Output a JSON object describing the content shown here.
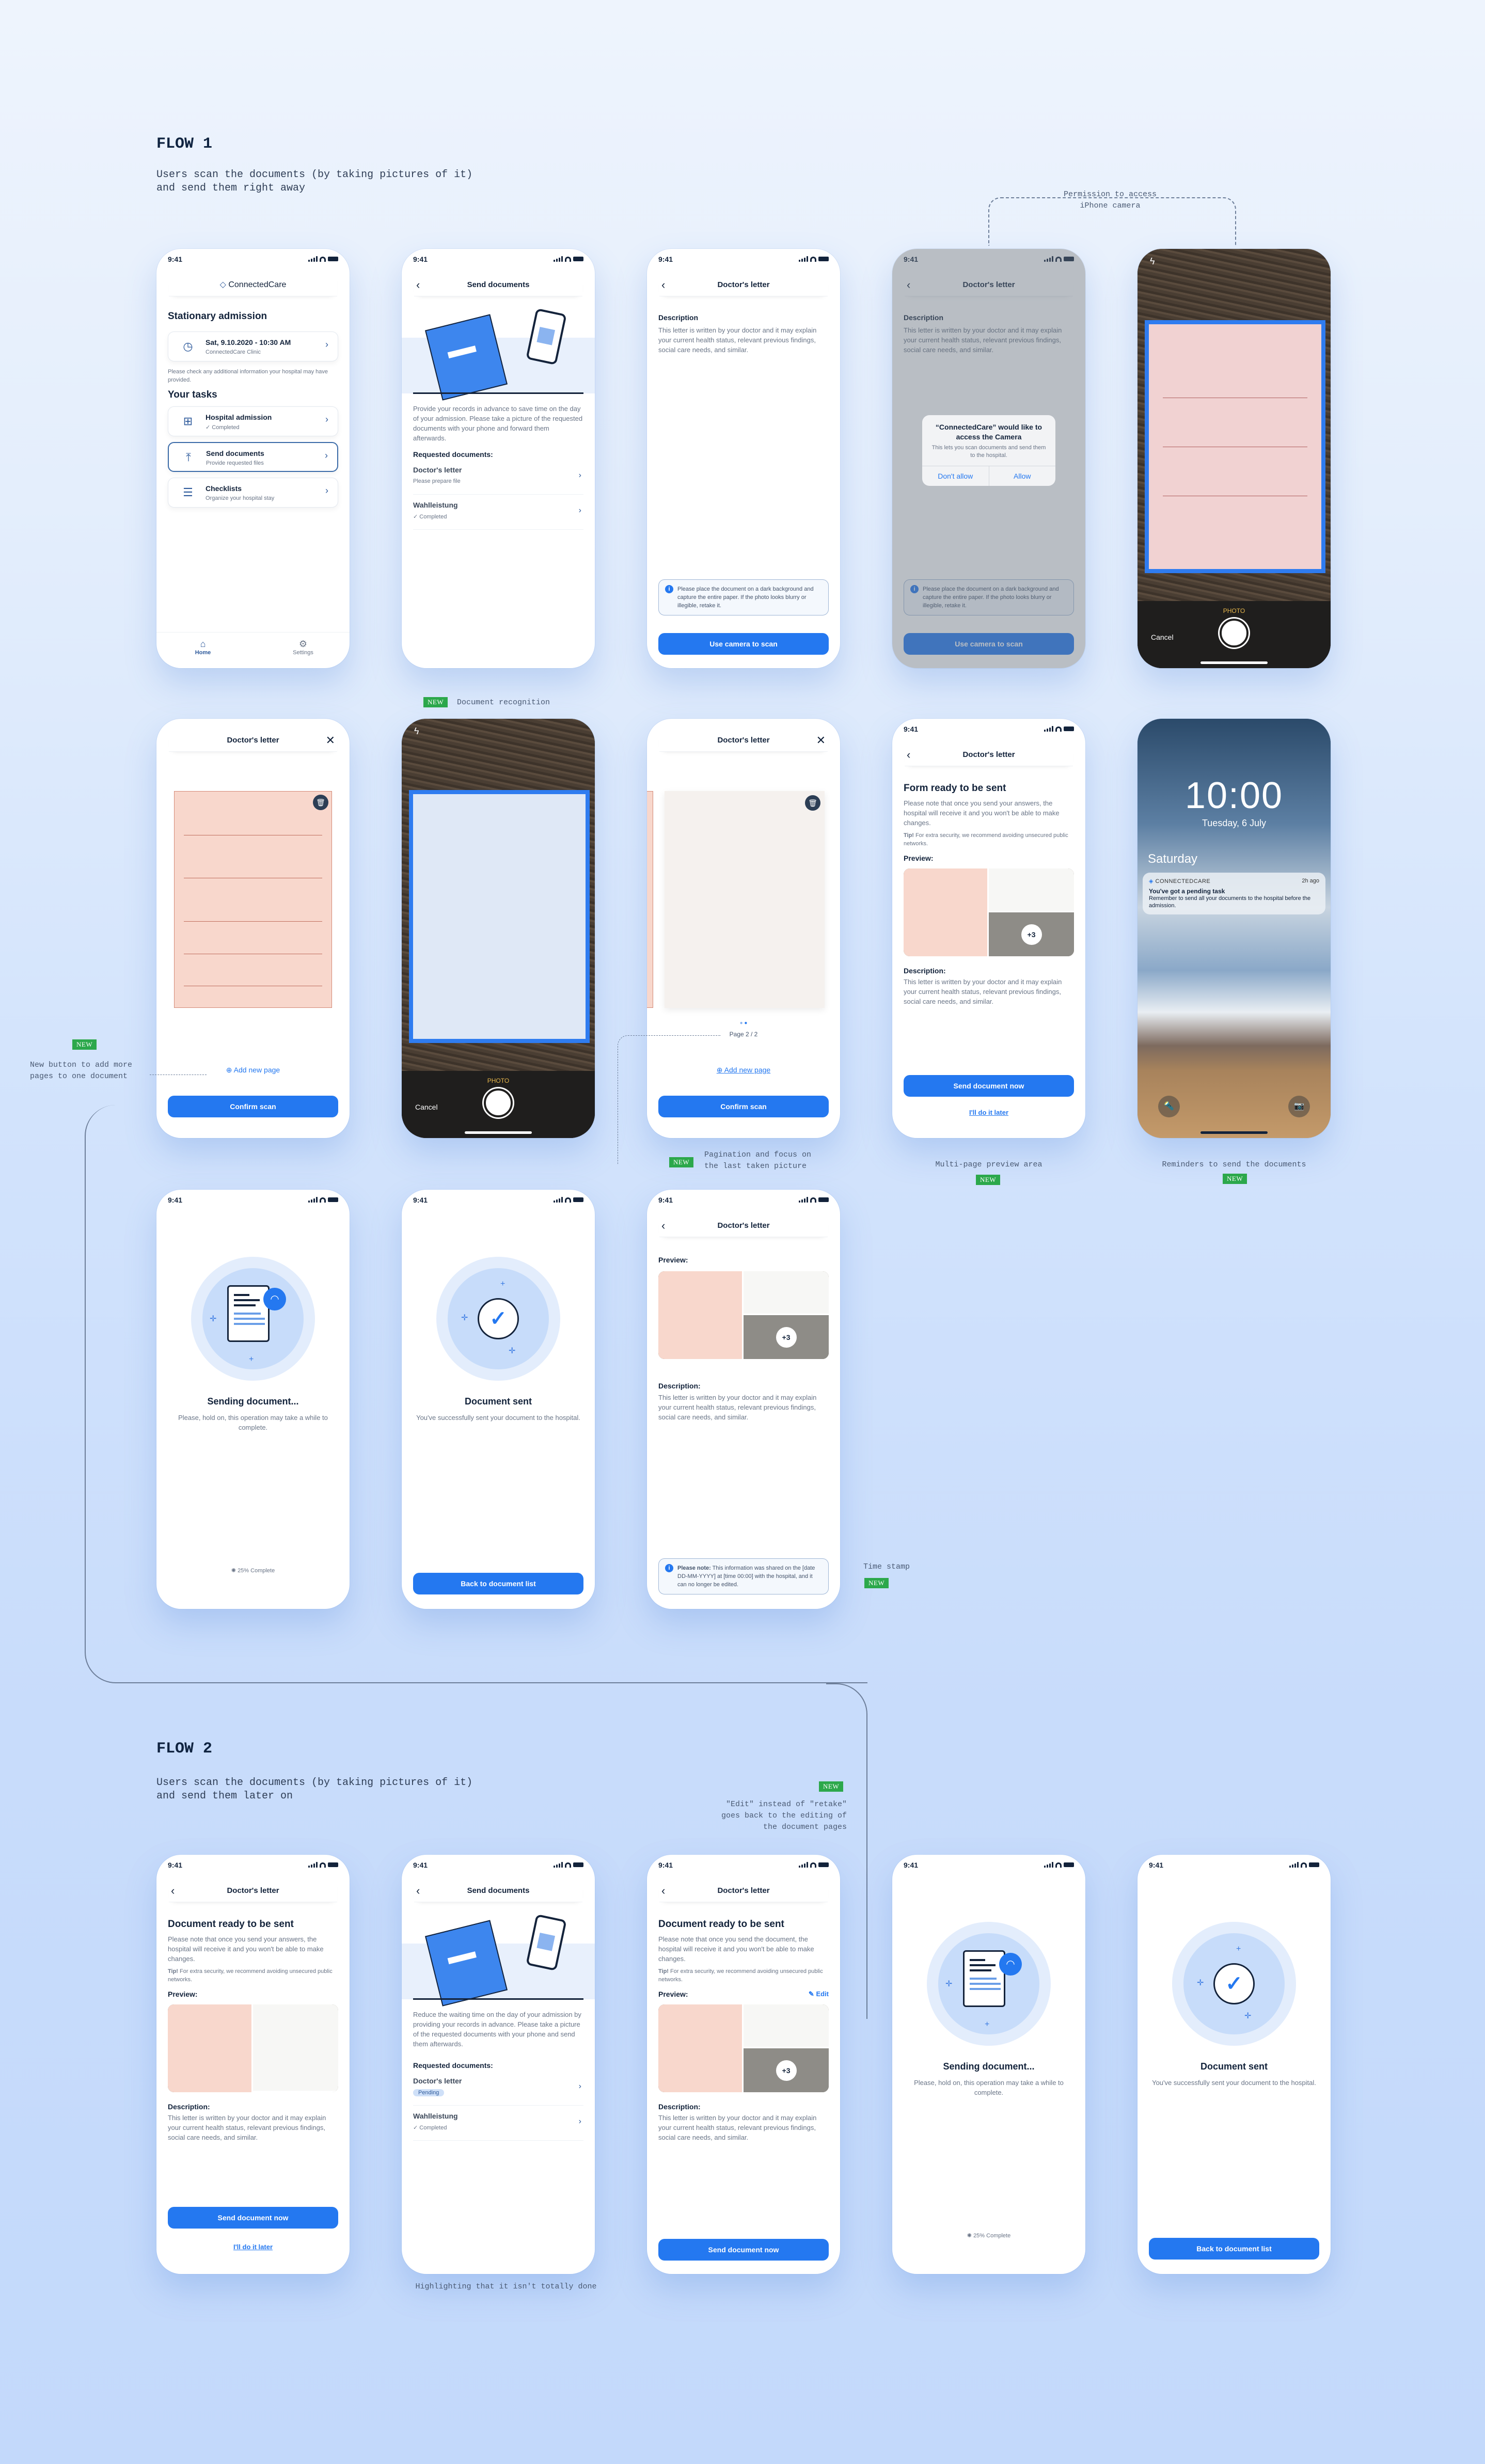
{
  "flow1": {
    "title": "FLOW 1",
    "subtitle": "Users scan the documents (by taking pictures of it)\nand send them right away"
  },
  "flow2": {
    "title": "FLOW 2",
    "subtitle": "Users scan the documents (by taking pictures of it)\nand send them later on"
  },
  "annotations": {
    "permission": "Permission to access\niPhone camera",
    "doc_recognition": "Document recognition",
    "add_page": "New button to add more\npages to one document",
    "pagination": "Pagination and focus on\nthe last taken picture",
    "multipage": "Multi-page preview area",
    "reminders": "Reminders to send the documents",
    "timestamp": "Time stamp",
    "edit": "\"Edit\" instead of \"retake\"\ngoes back to the editing of\nthe document pages",
    "highlight": "Highlighting that it isn't totally done",
    "new_badge": "NEW"
  },
  "status": {
    "time": "9:41"
  },
  "home": {
    "brand": "ConnectedCare",
    "section1": "Stationary admission",
    "appointment": {
      "title": "Sat, 9.10.2020 - 10:30 AM",
      "subtitle": "ConnectedCare Clinic"
    },
    "hint": "Please check any additional information your hospital may have provided.",
    "section2": "Your tasks",
    "tasks": [
      {
        "title": "Hospital admission",
        "subtitle": "✓ Completed"
      },
      {
        "title": "Send documents",
        "subtitle": "Provide requested files"
      },
      {
        "title": "Checklists",
        "subtitle": "Organize your hospital stay"
      }
    ],
    "tabs": [
      {
        "label": "Home"
      },
      {
        "label": "Settings"
      }
    ]
  },
  "send_docs": {
    "title": "Send documents",
    "intro": "Provide your records in advance to save time on the day of your admission. Please take a picture of the requested documents with your phone and forward them afterwards.",
    "intro2": "Reduce the waiting time on the day of your admission by providing your records in advance. Please take a picture of the requested documents with your phone and send them afterwards.",
    "requested_label": "Requested documents:",
    "docs": [
      {
        "name": "Doctor's letter",
        "status": "Please prepare file",
        "status2": "Pending"
      },
      {
        "name": "Wahlleistung",
        "status": "✓ Completed"
      }
    ]
  },
  "letter": {
    "title": "Doctor's letter",
    "description_label": "Description",
    "description_label2": "Description:",
    "description": "This letter is written by your doctor and it may explain your current health status, relevant previous findings, social care needs, and similar.",
    "info": "Please place the document on a dark background and capture the entire paper. If the photo looks blurry or illegible, retake it.",
    "scan_button": "Use camera to scan"
  },
  "permission_alert": {
    "title": "“ConnectedCare” would like to access the Camera",
    "body": "This lets you scan documents and send them to the hospital.",
    "deny": "Don't allow",
    "allow": "Allow"
  },
  "camera": {
    "mode": "PHOTO",
    "cancel": "Cancel"
  },
  "confirm": {
    "add_page": "Add new page",
    "confirm_button": "Confirm scan",
    "page_indicator": "Page 2 / 2"
  },
  "ready": {
    "title1": "Form ready to be sent",
    "title2": "Document ready to be sent",
    "note1": "Please note that once you send your answers, the hospital will receive it and you won't be able to make changes.",
    "note2": "Please note that once you send the document, the hospital will receive it and you won't be able to make changes.",
    "tip_label": "Tip!",
    "tip": "For extra security, we recommend avoiding unsecured public networks.",
    "preview_label": "Preview:",
    "more_count": "+3",
    "edit": "Edit",
    "send_button": "Send document now",
    "later_link": "I'll do it later"
  },
  "lockscreen": {
    "time": "10:00",
    "date": "Tuesday, 6 July",
    "day": "Saturday",
    "notification": {
      "app": "CONNECTEDCARE",
      "ago": "2h ago",
      "title": "You've got a pending task",
      "body": "Remember to send all your documents to the hospital before the admission."
    }
  },
  "sending": {
    "title": "Sending document...",
    "body": "Please, hold on, this operation may take a while to complete.",
    "progress": "25% Complete",
    "progress_value": 25
  },
  "sent": {
    "title": "Document sent",
    "body": "You've successfully sent your document to the hospital.",
    "button": "Back to document list"
  },
  "shared": {
    "label": "Please note:",
    "text": "This information was shared on the [date DD-MM-YYYY] at [time 00:00] with the hospital, and it can no longer be edited."
  }
}
